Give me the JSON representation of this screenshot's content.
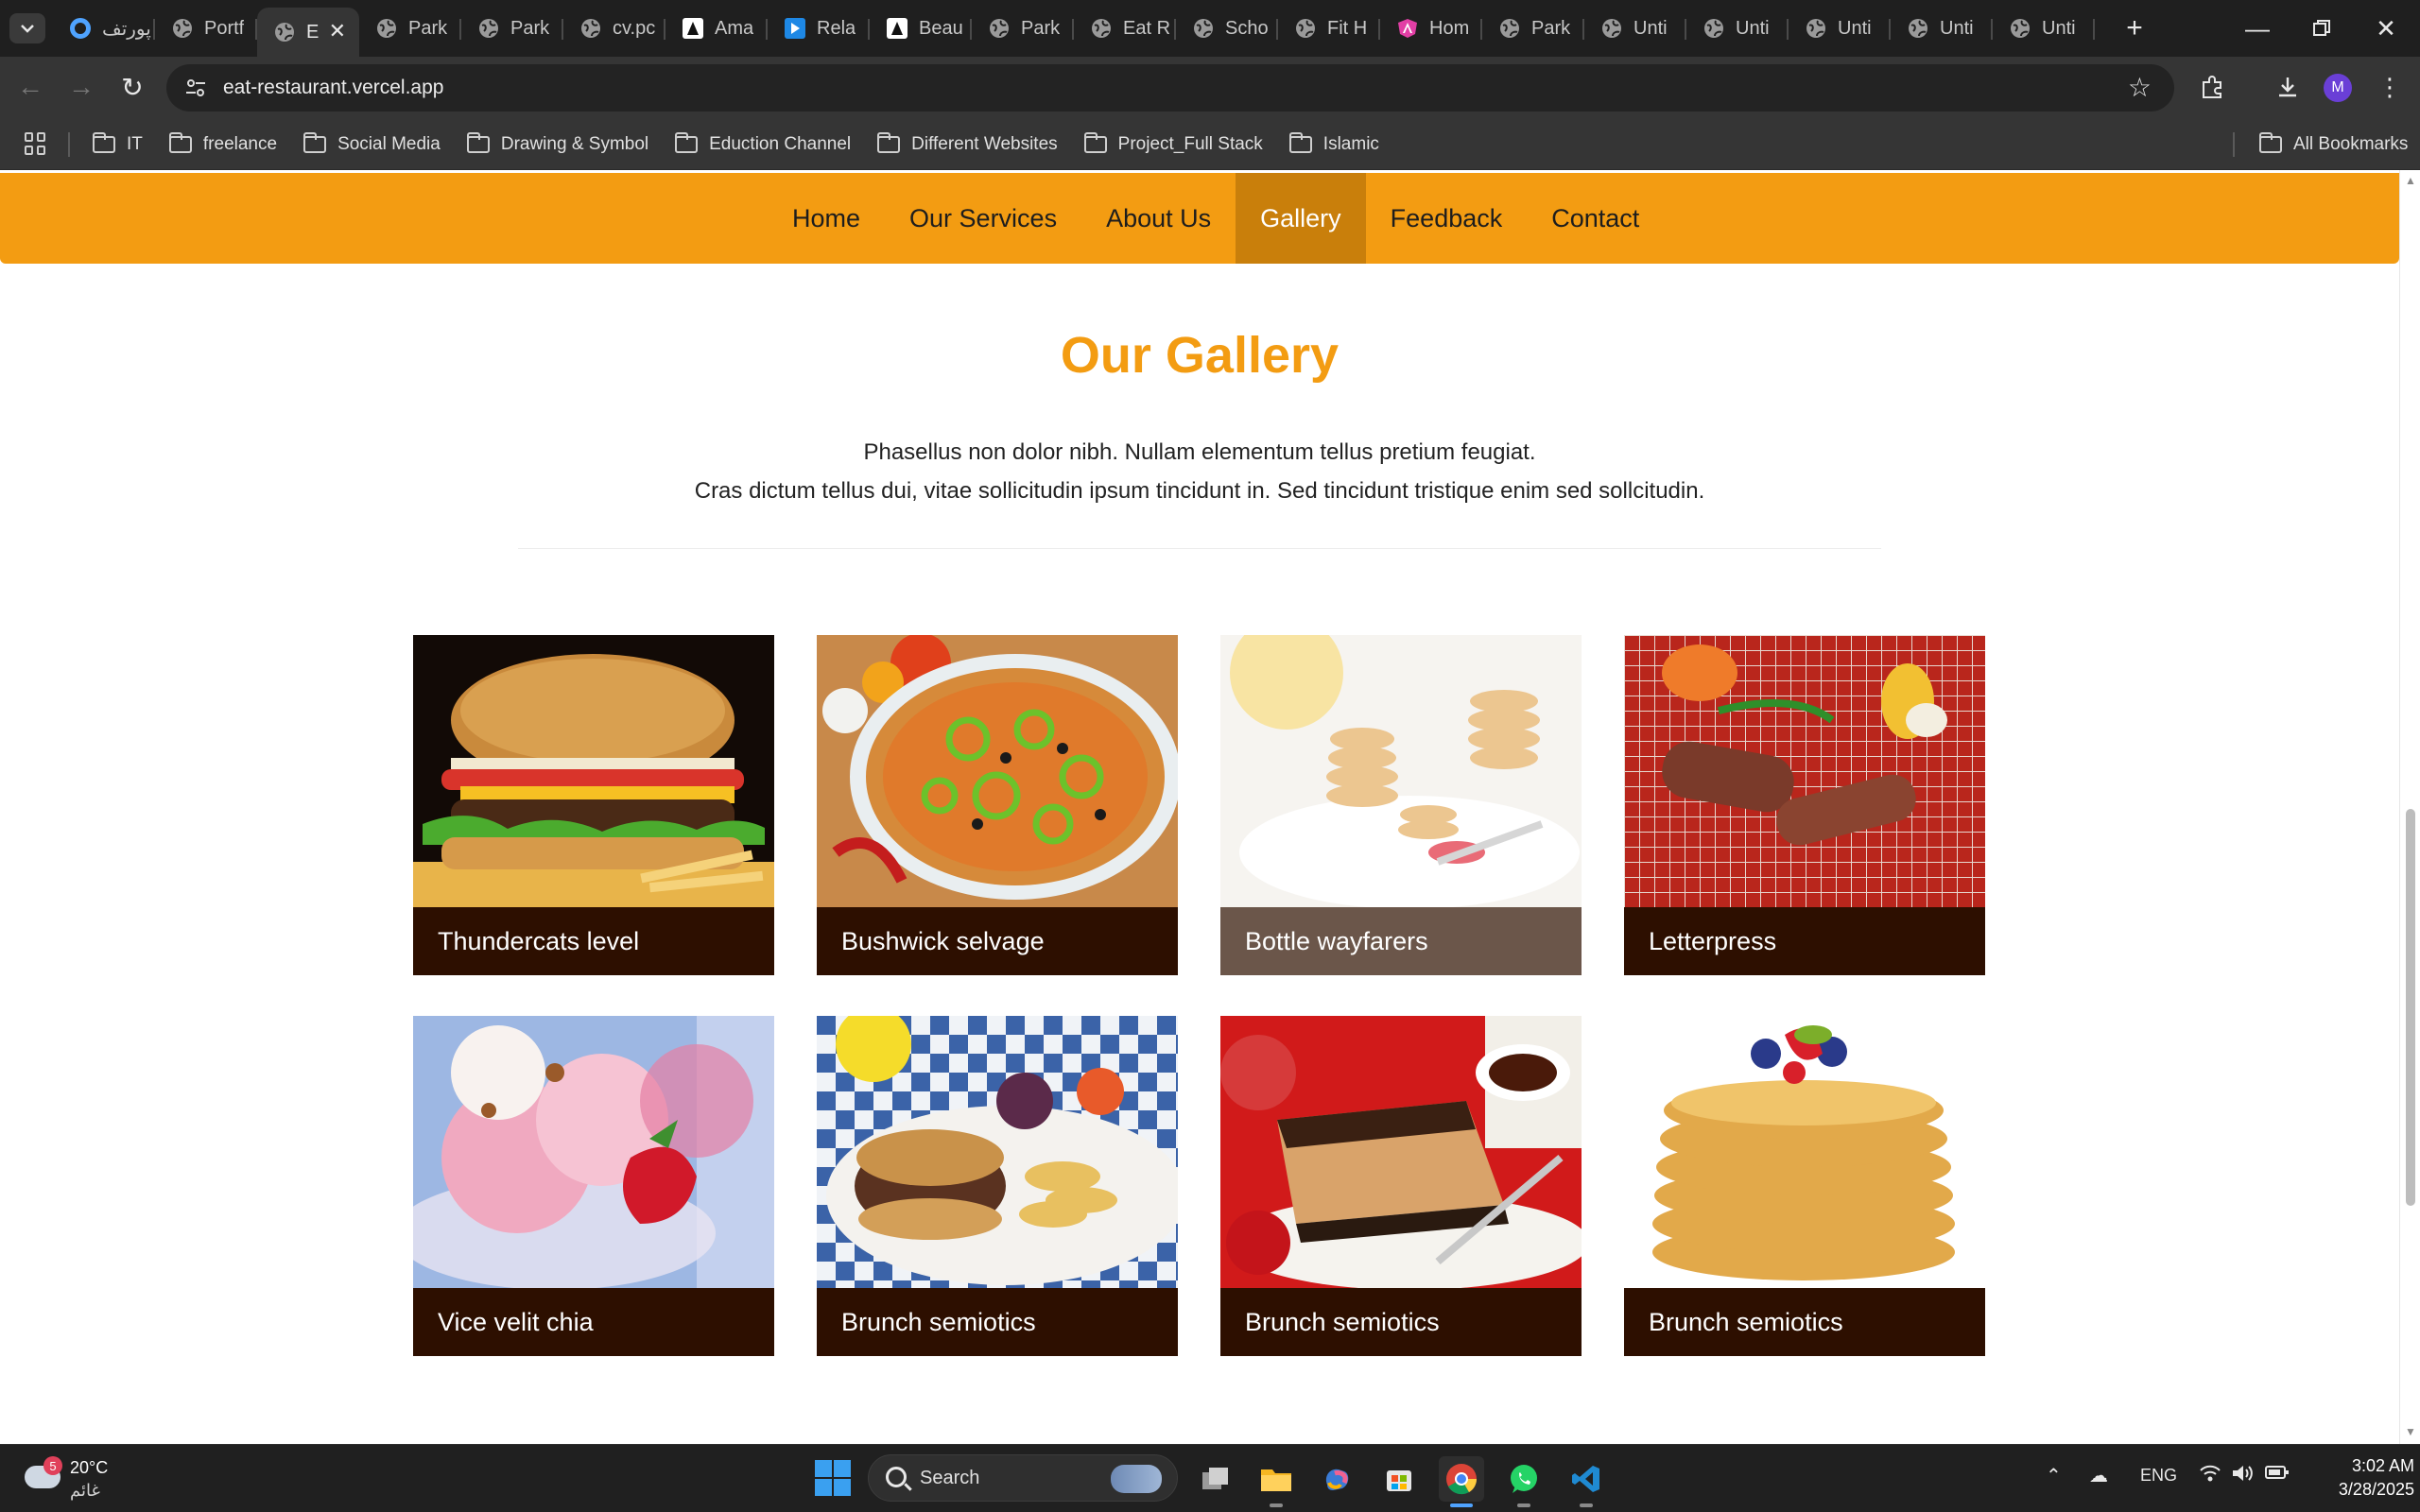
{
  "browser": {
    "tabs": [
      {
        "title": "پورتف",
        "icon": "ring-icon"
      },
      {
        "title": "Portf",
        "icon": "globe-icon"
      },
      {
        "title": "E",
        "icon": "globe-icon",
        "active": true
      },
      {
        "title": "Park",
        "icon": "globe-icon"
      },
      {
        "title": "Park",
        "icon": "globe-icon"
      },
      {
        "title": "cv.pc",
        "icon": "globe-icon"
      },
      {
        "title": "Ama",
        "icon": "dark-icon"
      },
      {
        "title": "Rela",
        "icon": "play-icon"
      },
      {
        "title": "Beau",
        "icon": "dark-icon"
      },
      {
        "title": "Park",
        "icon": "globe-icon"
      },
      {
        "title": "Eat R",
        "icon": "globe-icon"
      },
      {
        "title": "Scho",
        "icon": "globe-icon"
      },
      {
        "title": "Fit H",
        "icon": "globe-icon"
      },
      {
        "title": "Hom",
        "icon": "angular-icon"
      },
      {
        "title": "Park",
        "icon": "globe-icon"
      },
      {
        "title": "Unti",
        "icon": "globe-icon"
      },
      {
        "title": "Unti",
        "icon": "globe-icon"
      },
      {
        "title": "Unti",
        "icon": "globe-icon"
      },
      {
        "title": "Unti",
        "icon": "globe-icon"
      },
      {
        "title": "Unti",
        "icon": "globe-icon"
      }
    ],
    "url": "eat-restaurant.vercel.app",
    "profile_initial": "M",
    "bookmarks": [
      "IT",
      "freelance",
      "Social Media",
      "Drawing & Symbol",
      "Eduction Channel",
      "Different Websites",
      "Project_Full Stack",
      "Islamic"
    ],
    "all_bookmarks_label": "All Bookmarks"
  },
  "site": {
    "nav": [
      "Home",
      "Our Services",
      "About Us",
      "Gallery",
      "Feedback",
      "Contact"
    ],
    "active_nav": "Gallery",
    "accent_color": "#f39c12",
    "section_title": "Our Gallery",
    "description_line1": "Phasellus non dolor nibh. Nullam elementum tellus pretium feugiat.",
    "description_line2": "Cras dictum tellus dui, vitae sollicitudin ipsum tincidunt in. Sed tincidunt tristique enim sed sollcitudin.",
    "gallery": [
      {
        "caption": "Thundercats level",
        "image": "burger"
      },
      {
        "caption": "Bushwick selvage",
        "image": "pizza"
      },
      {
        "caption": "Bottle wayfarers",
        "image": "pancake-bites",
        "hovered": true
      },
      {
        "caption": "Letterpress",
        "image": "grilled-sausages"
      },
      {
        "caption": "Vice velit chia",
        "image": "strawberry-ice-cream"
      },
      {
        "caption": "Brunch semiotics",
        "image": "burger-plate"
      },
      {
        "caption": "Brunch semiotics",
        "image": "cheesecake"
      },
      {
        "caption": "Brunch semiotics",
        "image": "pancake-stack"
      }
    ]
  },
  "taskbar": {
    "weather_temp": "20°C",
    "weather_desc": "غائم",
    "weather_badge": "5",
    "search_placeholder": "Search",
    "language": "ENG",
    "time": "3:02 AM",
    "date": "3/28/2025"
  }
}
